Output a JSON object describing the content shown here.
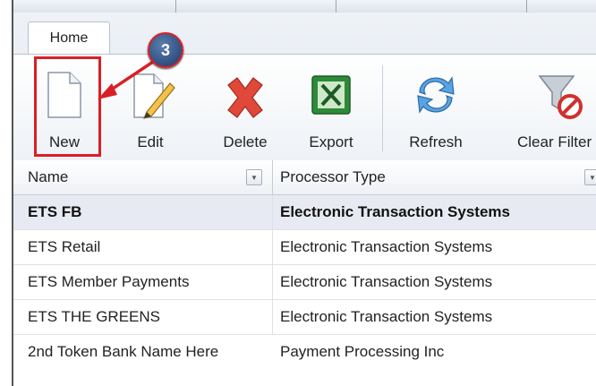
{
  "tabs": {
    "home": "Home"
  },
  "toolbar": {
    "buttons": [
      {
        "label": "New",
        "icon": "new-document-icon"
      },
      {
        "label": "Edit",
        "icon": "edit-pencil-icon"
      },
      {
        "label": "Delete",
        "icon": "delete-x-icon"
      },
      {
        "label": "Export",
        "icon": "excel-export-icon"
      },
      {
        "label": "Refresh",
        "icon": "refresh-icon"
      },
      {
        "label": "Clear Filter",
        "icon": "clear-filter-icon"
      }
    ]
  },
  "callout": {
    "step": "3"
  },
  "grid": {
    "columns": [
      "Name",
      "Processor Type"
    ],
    "rows": [
      [
        "ETS FB",
        "Electronic Transaction Systems"
      ],
      [
        "ETS Retail",
        "Electronic Transaction Systems"
      ],
      [
        "ETS Member Payments",
        "Electronic Transaction Systems"
      ],
      [
        "ETS THE GREENS",
        "Electronic Transaction Systems"
      ],
      [
        "2nd Token Bank Name Here",
        "Payment Processing Inc"
      ]
    ]
  },
  "colors": {
    "highlight": "#d91f26",
    "callout_fill": "#1d3a6a",
    "selected_row": "#e8eaf3"
  }
}
